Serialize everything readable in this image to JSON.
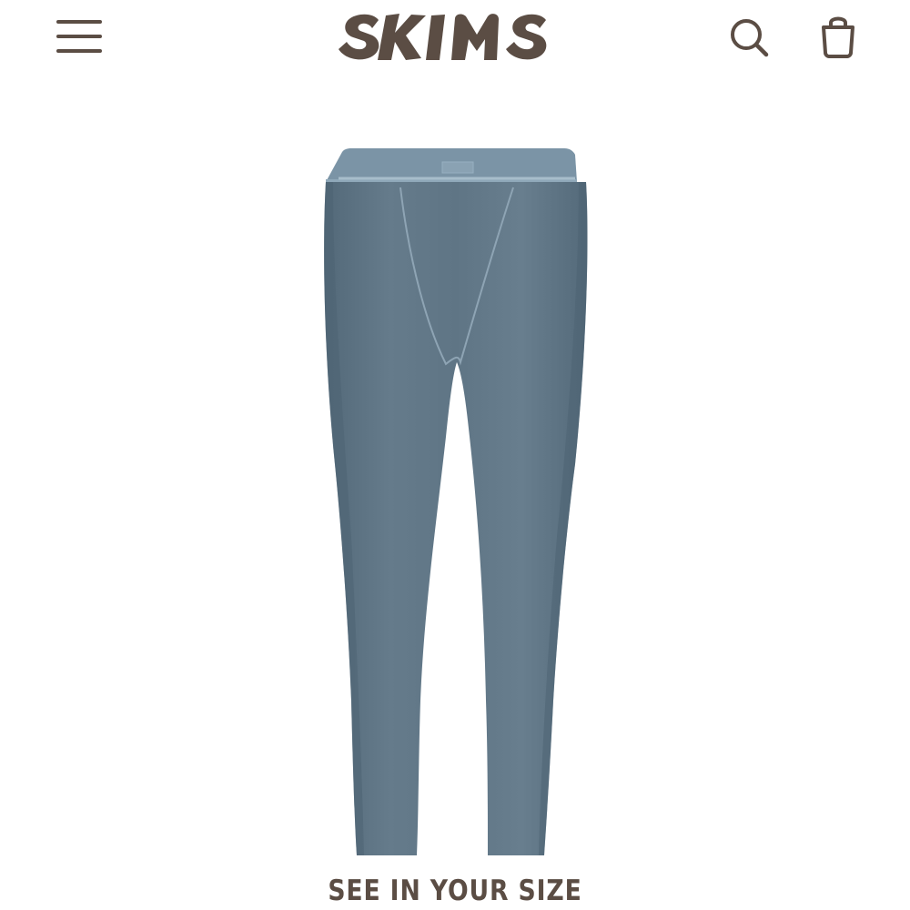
{
  "header": {
    "brand": "SKIMS",
    "menu_icon": "hamburger-menu-icon",
    "search_icon": "search-icon",
    "bag_icon": "shopping-bag-icon"
  },
  "product": {
    "image_alt": "leggings",
    "size_button_label": "SEE IN YOUR SIZE"
  },
  "colors": {
    "brand": "#5b4d44",
    "product": "#607686",
    "waistband": "#7b94a6",
    "background": "#ffffff"
  }
}
